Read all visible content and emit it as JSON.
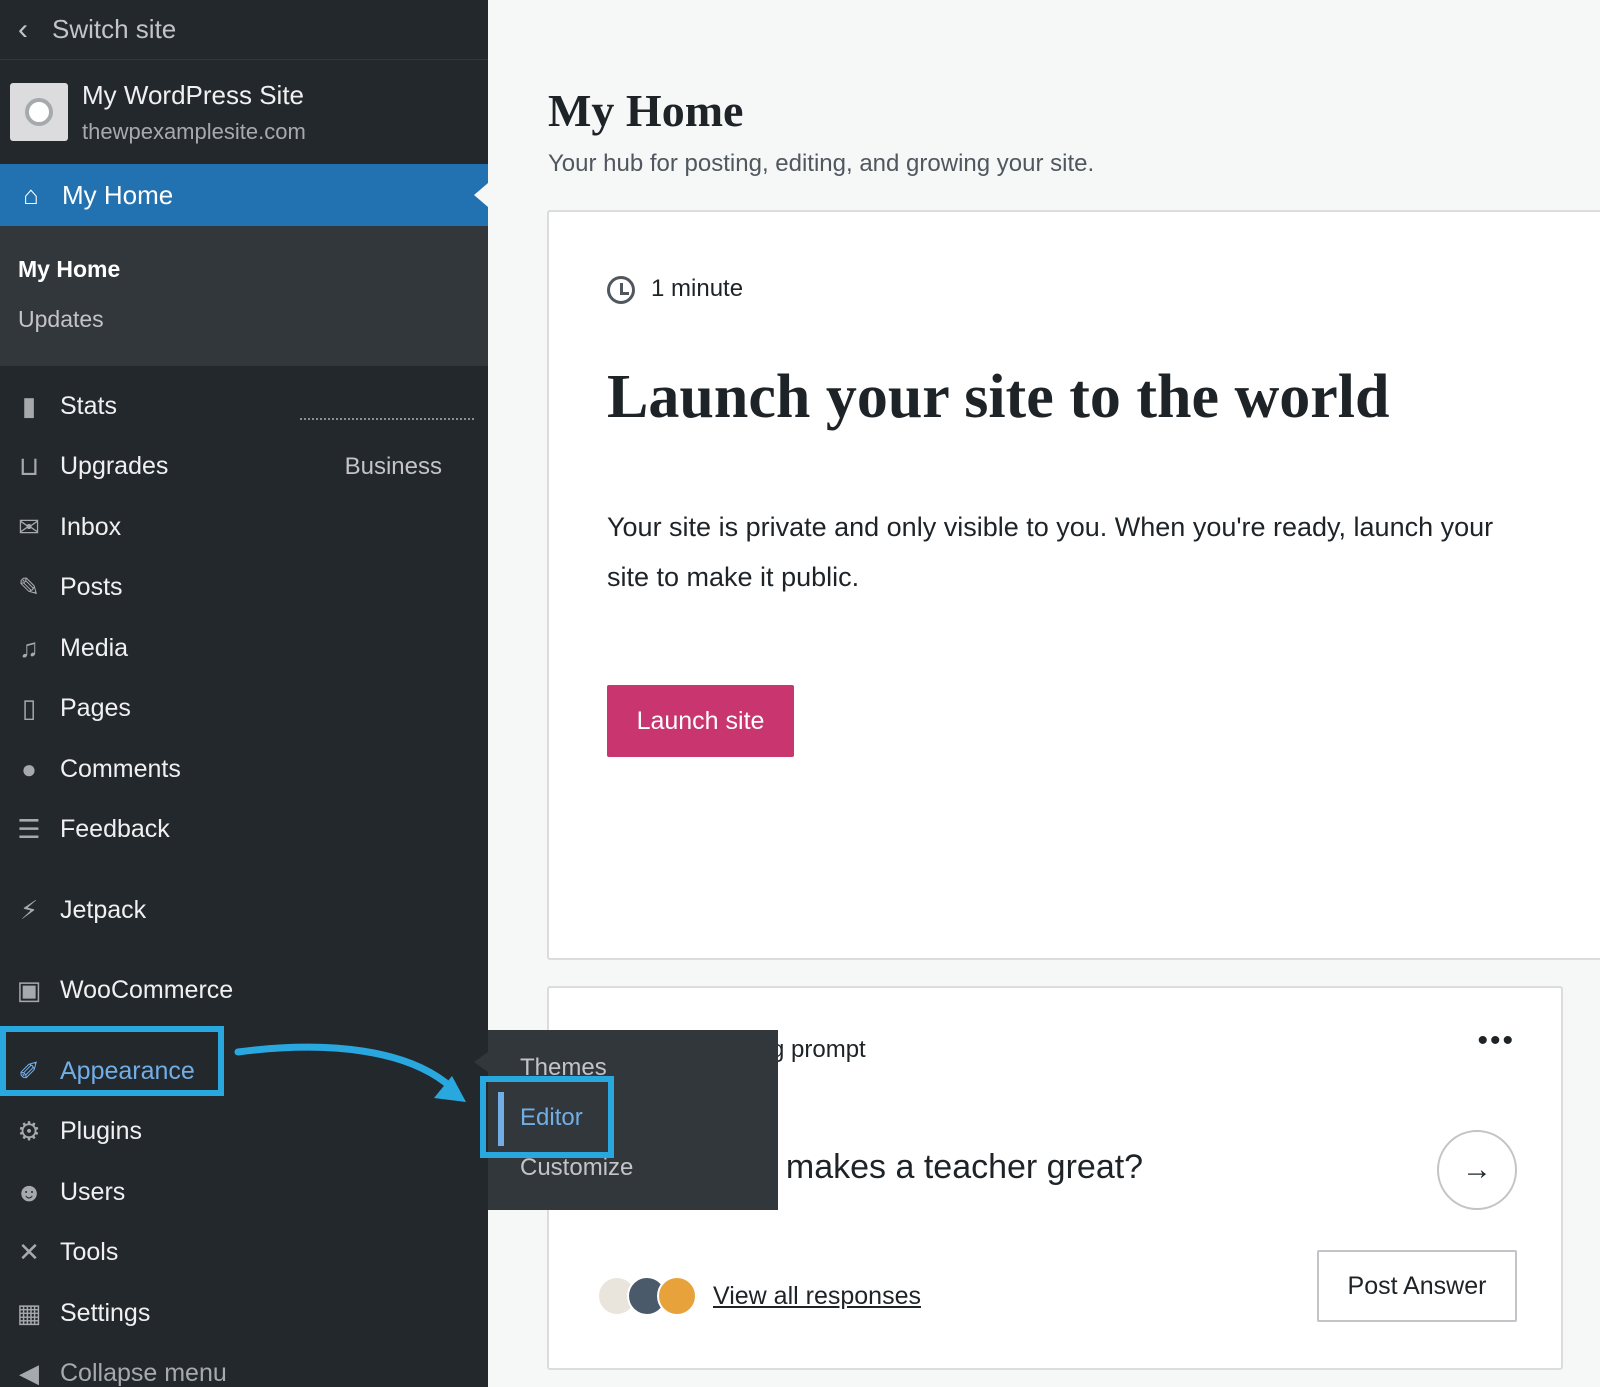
{
  "sidebar": {
    "switch_site": "Switch site",
    "site_name": "My WordPress Site",
    "site_url": "thewpexamplesite.com",
    "active_item": "My Home",
    "submenu": [
      "My Home",
      "Updates"
    ],
    "items": [
      {
        "label": "Stats",
        "icon": "stats-icon"
      },
      {
        "label": "Upgrades",
        "icon": "cart-icon",
        "badge": "Business"
      },
      {
        "label": "Inbox",
        "icon": "mail-icon"
      },
      {
        "label": "Posts",
        "icon": "pin-icon"
      },
      {
        "label": "Media",
        "icon": "media-icon"
      },
      {
        "label": "Pages",
        "icon": "pages-icon"
      },
      {
        "label": "Comments",
        "icon": "comment-icon"
      },
      {
        "label": "Feedback",
        "icon": "feedback-icon"
      },
      {
        "label": "Jetpack",
        "icon": "jetpack-icon"
      },
      {
        "label": "WooCommerce",
        "icon": "woo-icon"
      },
      {
        "label": "Appearance",
        "icon": "brush-icon"
      },
      {
        "label": "Plugins",
        "icon": "plug-icon"
      },
      {
        "label": "Users",
        "icon": "user-icon"
      },
      {
        "label": "Tools",
        "icon": "wrench-icon"
      },
      {
        "label": "Settings",
        "icon": "settings-icon"
      },
      {
        "label": "Collapse menu",
        "icon": "collapse-icon"
      }
    ]
  },
  "flyout": {
    "items": [
      "Themes",
      "Editor",
      "Customize"
    ]
  },
  "main": {
    "title": "My Home",
    "subtitle": "Your hub for posting, editing, and growing your site.",
    "launch_card": {
      "duration": "1 minute",
      "heading": "Launch your site to the world",
      "body": "Your site is private and only visible to you. When you're ready, launch your site to make it public.",
      "button": "Launch site"
    },
    "prompt_card": {
      "label": "g prompt",
      "more": "•••",
      "question": "t makes a teacher great?",
      "arrow": "→",
      "view_all": "View all responses",
      "post_answer": "Post Answer"
    }
  },
  "colors": {
    "sidebar_bg": "#23282d",
    "active_blue": "#2271b1",
    "launch_pink": "#c9356e",
    "highlight": "#29a8e0"
  }
}
